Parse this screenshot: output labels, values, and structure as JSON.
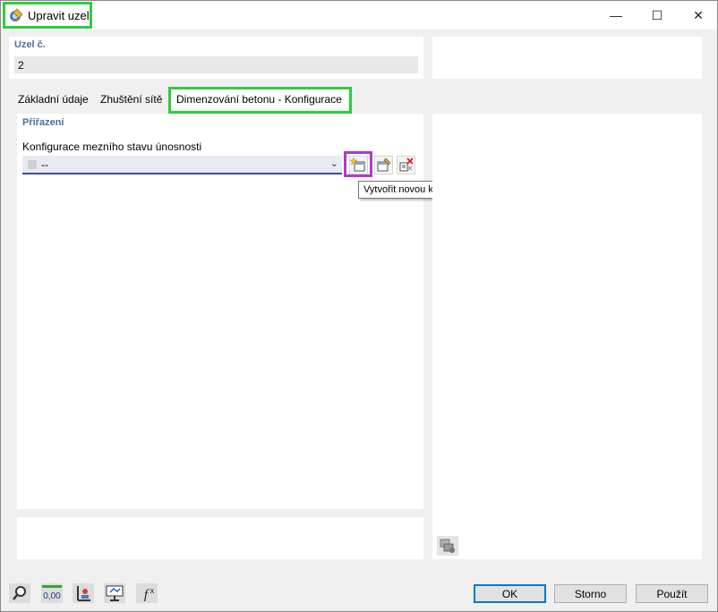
{
  "window": {
    "title": "Upravit uzel",
    "controls": {
      "minimize": "—",
      "maximize": "☐",
      "close": "✕"
    }
  },
  "node": {
    "number_label": "Uzel č.",
    "number_value": "2"
  },
  "tabs": [
    {
      "label": "Základní údaje",
      "active": false
    },
    {
      "label": "Zhuštění sítě",
      "active": false
    },
    {
      "label": "Dimenzování betonu - Konfigurace",
      "active": true
    }
  ],
  "assignment": {
    "section_title": "Přiřazení",
    "uls_label": "Konfigurace mezního stavu únosnosti",
    "uls_value": "--",
    "tooltip": "Vytvořit novou konfiguraci mezního stavu únosnosti"
  },
  "toolbar_icons": [
    "new-config-icon",
    "edit-config-icon",
    "delete-config-icon"
  ],
  "footer": {
    "icons": [
      "search-magnifier-icon",
      "numeric-display-icon",
      "node-view-icon",
      "display-settings-icon",
      "formula-icon"
    ],
    "ok_label": "OK",
    "cancel_label": "Storno",
    "apply_label": "Použít"
  },
  "colors": {
    "highlight_green": "#2ecc40",
    "highlight_purple": "#b23ac9",
    "label_blue": "#4a6fa5",
    "default_button_border": "#0078d7"
  }
}
